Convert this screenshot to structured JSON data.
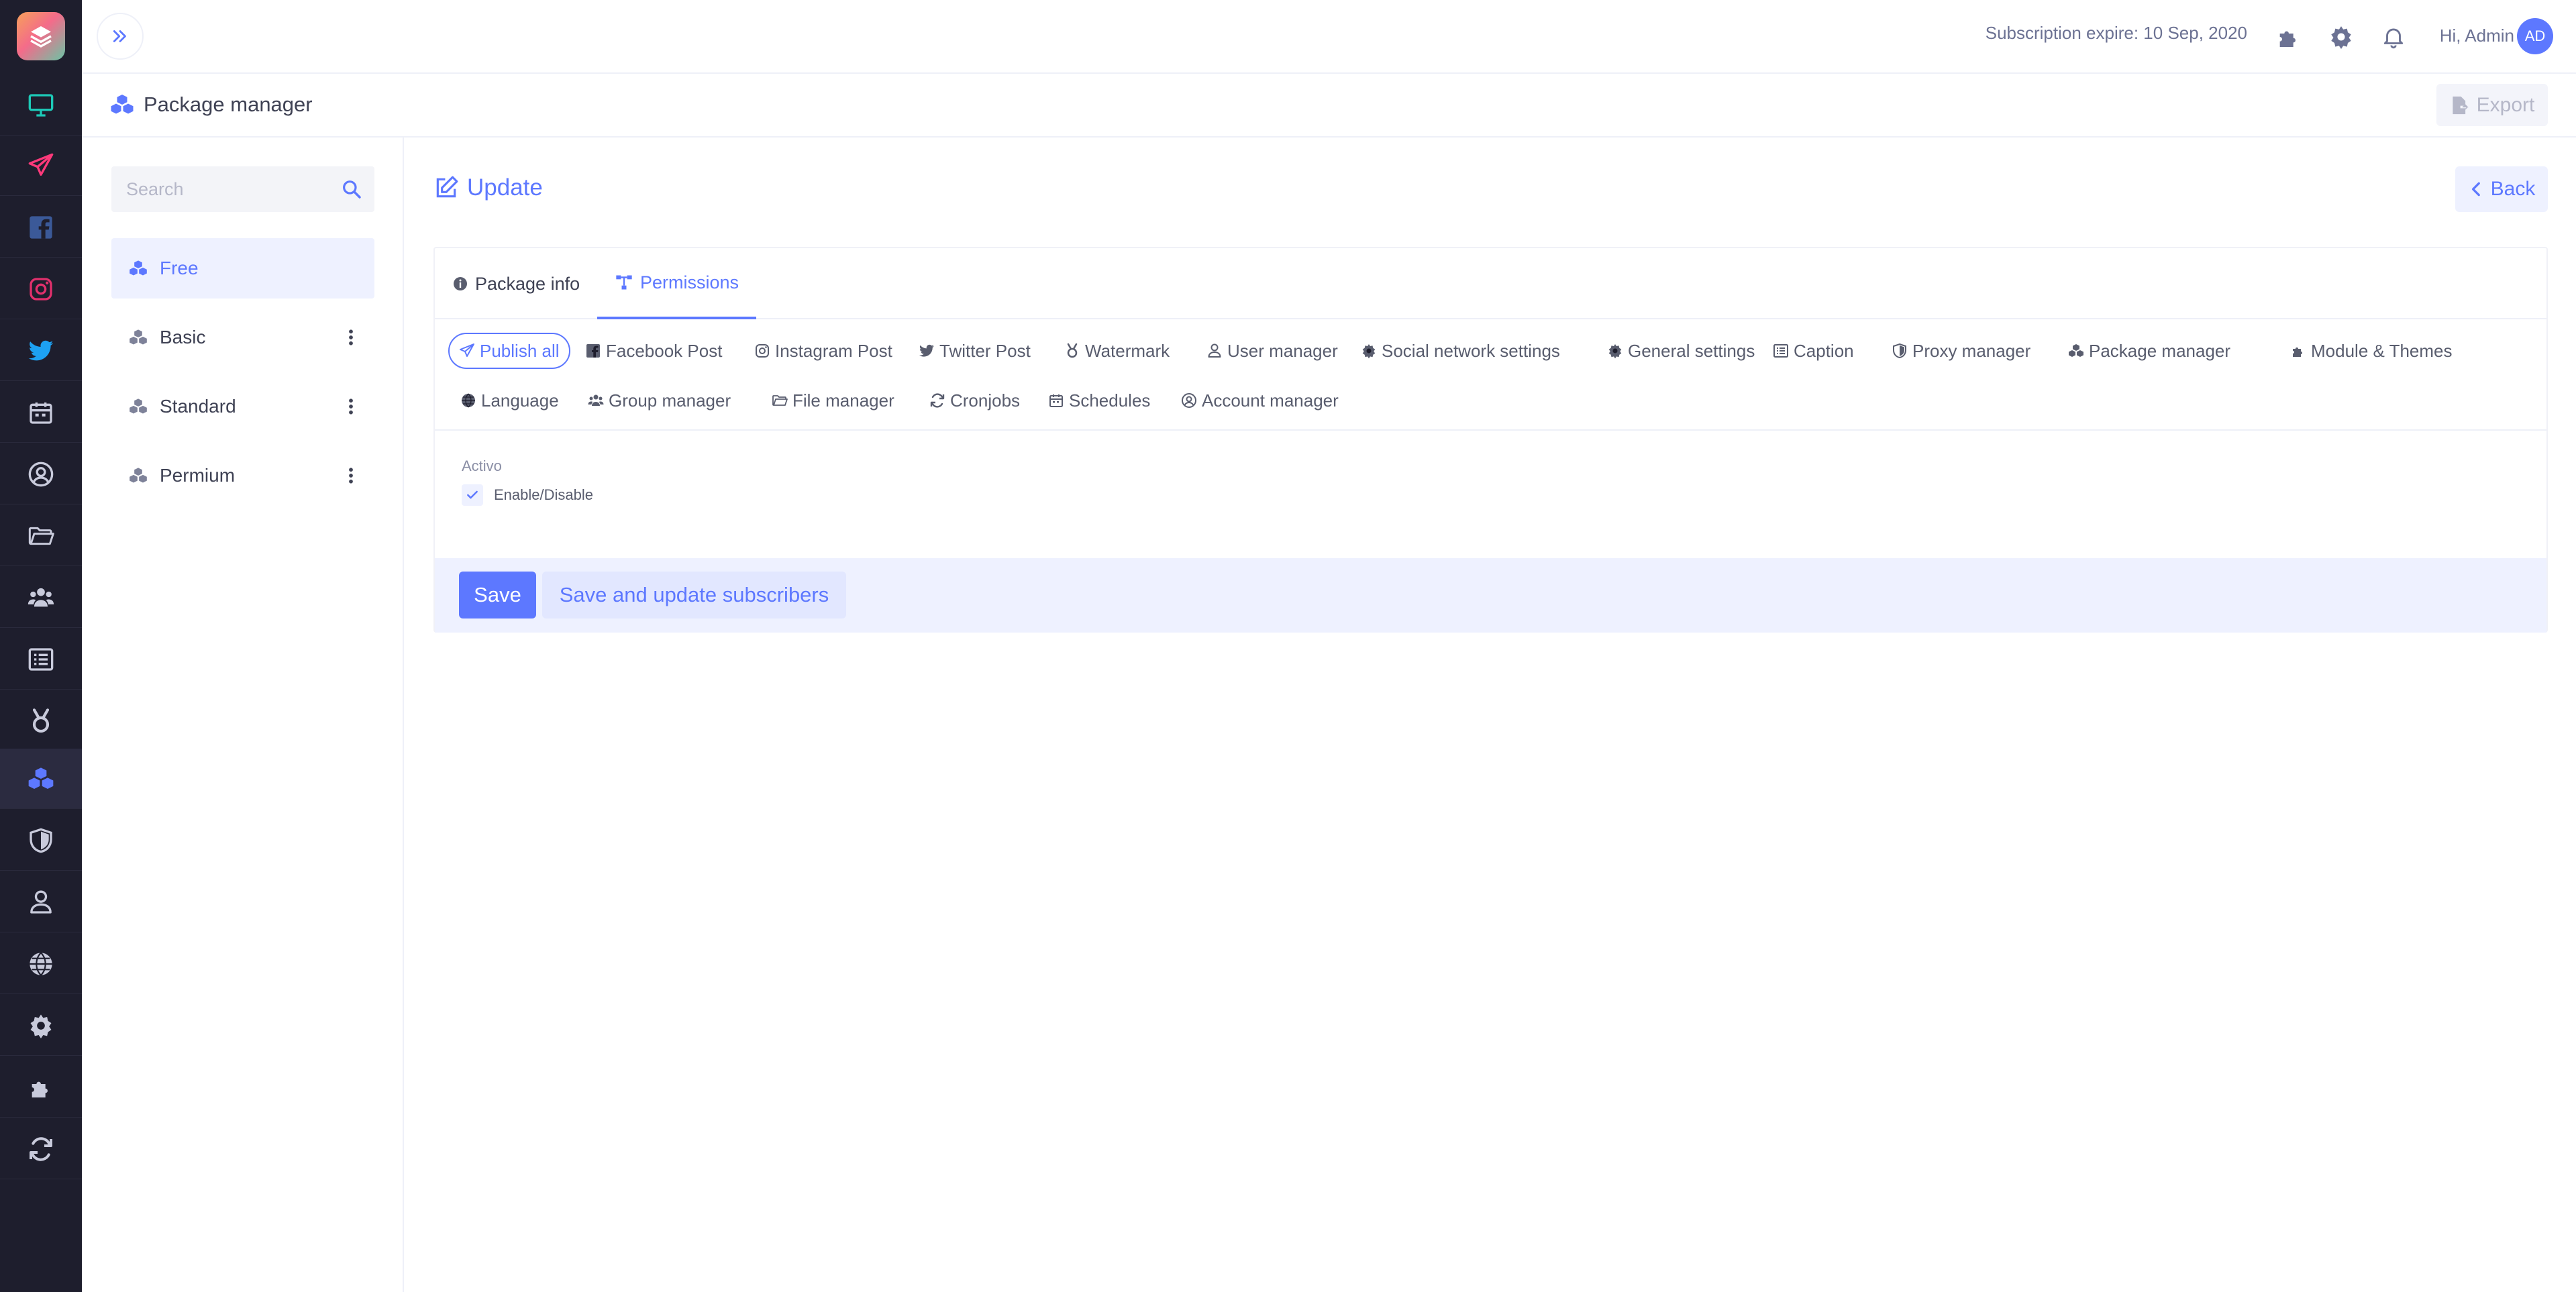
{
  "colors": {
    "accent": "#5d78ff",
    "sidebar_bg": "#1e1e2d"
  },
  "sidebar": {
    "items": [
      {
        "icon": "monitor-icon",
        "color": "#1dc9b7",
        "name": "sidebar-item-dashboard"
      },
      {
        "icon": "paper-plane-icon",
        "color": "#fd397a",
        "name": "sidebar-item-publish"
      },
      {
        "icon": "facebook-icon",
        "color": "#3b5998",
        "name": "sidebar-item-facebook"
      },
      {
        "icon": "instagram-icon",
        "color": "#e1306c",
        "name": "sidebar-item-instagram"
      },
      {
        "icon": "twitter-icon",
        "color": "#1da1f2",
        "name": "sidebar-item-twitter"
      },
      {
        "icon": "calendar-icon",
        "color": "#c8cadb",
        "name": "sidebar-item-schedules"
      },
      {
        "icon": "user-circle-icon",
        "color": "#c8cadb",
        "name": "sidebar-item-account-manager"
      },
      {
        "icon": "folder-icon",
        "color": "#c8cadb",
        "name": "sidebar-item-file-manager"
      },
      {
        "icon": "users-icon",
        "color": "#c8cadb",
        "name": "sidebar-item-group-manager"
      },
      {
        "icon": "list-icon",
        "color": "#c8cadb",
        "name": "sidebar-item-caption"
      },
      {
        "icon": "medal-icon",
        "color": "#c8cadb",
        "name": "sidebar-item-watermark"
      },
      {
        "icon": "cubes-icon",
        "color": "#5d78ff",
        "name": "sidebar-item-package-manager"
      },
      {
        "icon": "shield-icon",
        "color": "#c8cadb",
        "name": "sidebar-item-proxy-manager"
      },
      {
        "icon": "user-icon",
        "color": "#c8cadb",
        "name": "sidebar-item-user-manager"
      },
      {
        "icon": "globe-icon",
        "color": "#c8cadb",
        "name": "sidebar-item-language"
      },
      {
        "icon": "gear-icon",
        "color": "#c8cadb",
        "name": "sidebar-item-settings"
      },
      {
        "icon": "puzzle-icon",
        "color": "#c8cadb",
        "name": "sidebar-item-modules"
      },
      {
        "icon": "sync-icon",
        "color": "#c8cadb",
        "name": "sidebar-item-cronjobs"
      }
    ]
  },
  "header": {
    "subscription": "Subscription expire: 10 Sep, 2020",
    "greeting": "Hi, Admin",
    "avatar_initials": "AD",
    "icons": [
      "puzzle-icon",
      "gear-icon",
      "bell-icon"
    ]
  },
  "subheader": {
    "title": "Package manager",
    "export_label": "Export"
  },
  "packages": {
    "search_placeholder": "Search",
    "items": [
      {
        "label": "Free",
        "active": true
      },
      {
        "label": "Basic",
        "active": false
      },
      {
        "label": "Standard",
        "active": false
      },
      {
        "label": "Permium",
        "active": false
      }
    ]
  },
  "main": {
    "title": "Update",
    "back_label": "Back",
    "tabs": [
      {
        "label": "Package info",
        "icon": "info-circle-icon"
      },
      {
        "label": "Permissions",
        "icon": "sitemap-icon"
      }
    ],
    "permissions": [
      {
        "label": "Publish all",
        "icon": "paper-plane-icon"
      },
      {
        "label": "Facebook Post",
        "icon": "facebook-icon"
      },
      {
        "label": "Instagram Post",
        "icon": "instagram-icon"
      },
      {
        "label": "Twitter Post",
        "icon": "twitter-icon"
      },
      {
        "label": "Watermark",
        "icon": "medal-icon"
      },
      {
        "label": "User manager",
        "icon": "user-icon"
      },
      {
        "label": "Social network settings",
        "icon": "gear-icon"
      },
      {
        "label": "General settings",
        "icon": "gear-icon"
      },
      {
        "label": "Caption",
        "icon": "list-icon"
      },
      {
        "label": "Proxy manager",
        "icon": "shield-icon"
      },
      {
        "label": "Package manager",
        "icon": "cubes-icon"
      },
      {
        "label": "Module & Themes",
        "icon": "puzzle-icon"
      },
      {
        "label": "Language",
        "icon": "globe-icon"
      },
      {
        "label": "Group manager",
        "icon": "users-icon"
      },
      {
        "label": "File manager",
        "icon": "folder-icon"
      },
      {
        "label": "Cronjobs",
        "icon": "sync-icon"
      },
      {
        "label": "Schedules",
        "icon": "calendar-icon"
      },
      {
        "label": "Account manager",
        "icon": "user-circle-icon"
      }
    ],
    "field_label": "Activo",
    "checkbox_label": "Enable/Disable",
    "checkbox_checked": true,
    "save_label": "Save",
    "save_update_label": "Save and update subscribers"
  }
}
